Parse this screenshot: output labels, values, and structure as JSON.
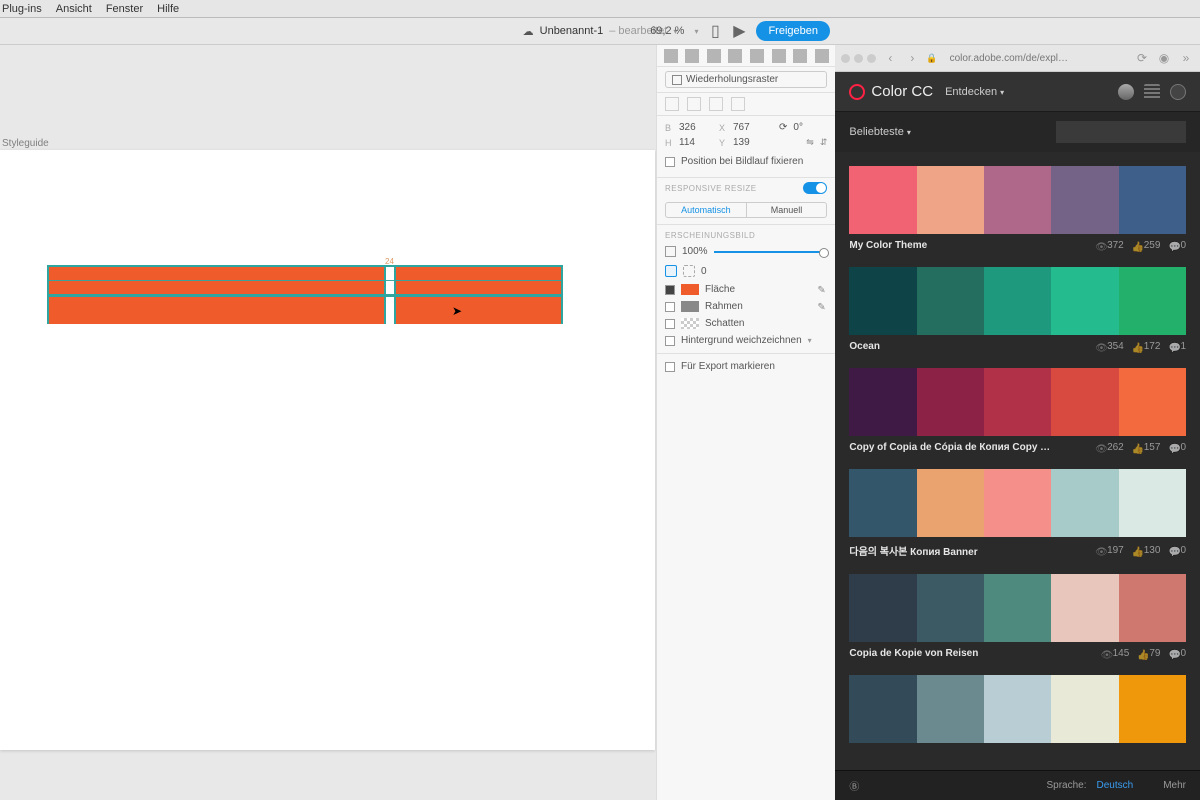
{
  "menubar": {
    "items": [
      "Plug-ins",
      "Ansicht",
      "Fenster",
      "Hilfe"
    ]
  },
  "titlebar": {
    "doc": "Unbenannt-1",
    "status": "– bearbeitet",
    "zoom": "69,2 %",
    "share": "Freigeben"
  },
  "canvas": {
    "artboard_label": "Styleguide",
    "gap_label": "24"
  },
  "props": {
    "repeat_grid": "Wiederholungsraster",
    "dims": {
      "b": "326",
      "x": "767",
      "rot": "0°",
      "h": "114",
      "y": "139"
    },
    "fix_scroll": "Position bei Bildlauf fixieren",
    "responsive_header": "RESPONSIVE RESIZE",
    "seg_auto": "Automatisch",
    "seg_manual": "Manuell",
    "appearance_header": "ERSCHEINUNGSBILD",
    "opacity": "100%",
    "corner": "0",
    "fill": "Fläche",
    "stroke": "Rahmen",
    "shadow": "Schatten",
    "blur": "Hintergrund weichzeichnen",
    "export": "Für Export markieren"
  },
  "colorcc": {
    "url": "color.adobe.com/de/expl…",
    "brand": "Color CC",
    "entdecken": "Entdecken",
    "filter": "Beliebteste",
    "lang_label": "Sprache:",
    "lang_value": "Deutsch",
    "mehr": "Mehr",
    "themes": [
      {
        "name": "My Color Theme",
        "views": "372",
        "likes": "259",
        "comments": "0",
        "colors": [
          "#f16272",
          "#efa487",
          "#b0688a",
          "#746387",
          "#3d5f8a"
        ]
      },
      {
        "name": "Ocean",
        "views": "354",
        "likes": "172",
        "comments": "1",
        "colors": [
          "#0e4447",
          "#236e5f",
          "#1f997d",
          "#24bb8e",
          "#22b06a"
        ]
      },
      {
        "name": "Copy of Copia de Cópia de Копия Copy …",
        "views": "262",
        "likes": "157",
        "comments": "0",
        "colors": [
          "#3f1a45",
          "#8c2246",
          "#b03148",
          "#d84a40",
          "#f36a3e"
        ]
      },
      {
        "name": "다음의 복사본 Копия Banner",
        "views": "197",
        "likes": "130",
        "comments": "0",
        "colors": [
          "#34566b",
          "#eaa36e",
          "#f48f89",
          "#a6cbc9",
          "#dae9e4"
        ]
      },
      {
        "name": "Copia de Kopie von Reisen",
        "views": "145",
        "likes": "79",
        "comments": "0",
        "colors": [
          "#2f3d4a",
          "#3c5a63",
          "#4e8a7d",
          "#e8c6bb",
          "#cf7870"
        ]
      },
      {
        "name": "",
        "views": "",
        "likes": "",
        "comments": "",
        "colors": [
          "#334a58",
          "#6b8a8f",
          "#b8cdd4",
          "#e8e9d6",
          "#f0980c"
        ]
      }
    ]
  }
}
